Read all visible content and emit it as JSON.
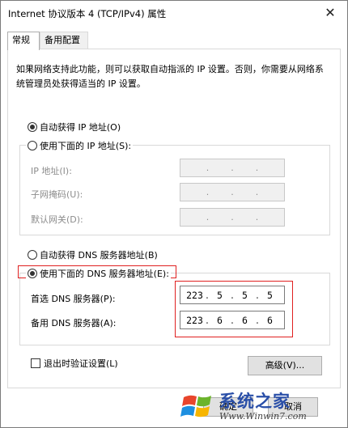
{
  "window": {
    "title": "Internet 协议版本 4 (TCP/IPv4) 属性",
    "close_glyph": "✕"
  },
  "tabs": [
    {
      "label": "常规"
    },
    {
      "label": "备用配置"
    }
  ],
  "intro": "如果网络支持此功能，则可以获取自动指派的 IP 设置。否则，你需要从网络系统管理员处获得适当的 IP 设置。",
  "ip": {
    "auto_label": "自动获得 IP 地址(O)",
    "manual_label": "使用下面的 IP 地址(S):",
    "address_label": "IP 地址(I):",
    "subnet_label": "子网掩码(U):",
    "gateway_label": "默认网关(D):"
  },
  "dns": {
    "auto_label": "自动获得 DNS 服务器地址(B)",
    "manual_label": "使用下面的 DNS 服务器地址(E):",
    "preferred_label": "首选 DNS 服务器(P):",
    "alternate_label": "备用 DNS 服务器(A):",
    "preferred": [
      "223",
      "5",
      "5",
      "5"
    ],
    "alternate": [
      "223",
      "6",
      "6",
      "6"
    ]
  },
  "validate_label": "退出时验证设置(L)",
  "advanced_button": "高级(V)...",
  "ok_button": "确定",
  "cancel_button": "取消",
  "watermark": {
    "text": "系统之家",
    "url": "Www.Winwin7.com"
  },
  "colors": {
    "highlight_border": "#e02020",
    "watermark_text": "#2a4fa8"
  }
}
